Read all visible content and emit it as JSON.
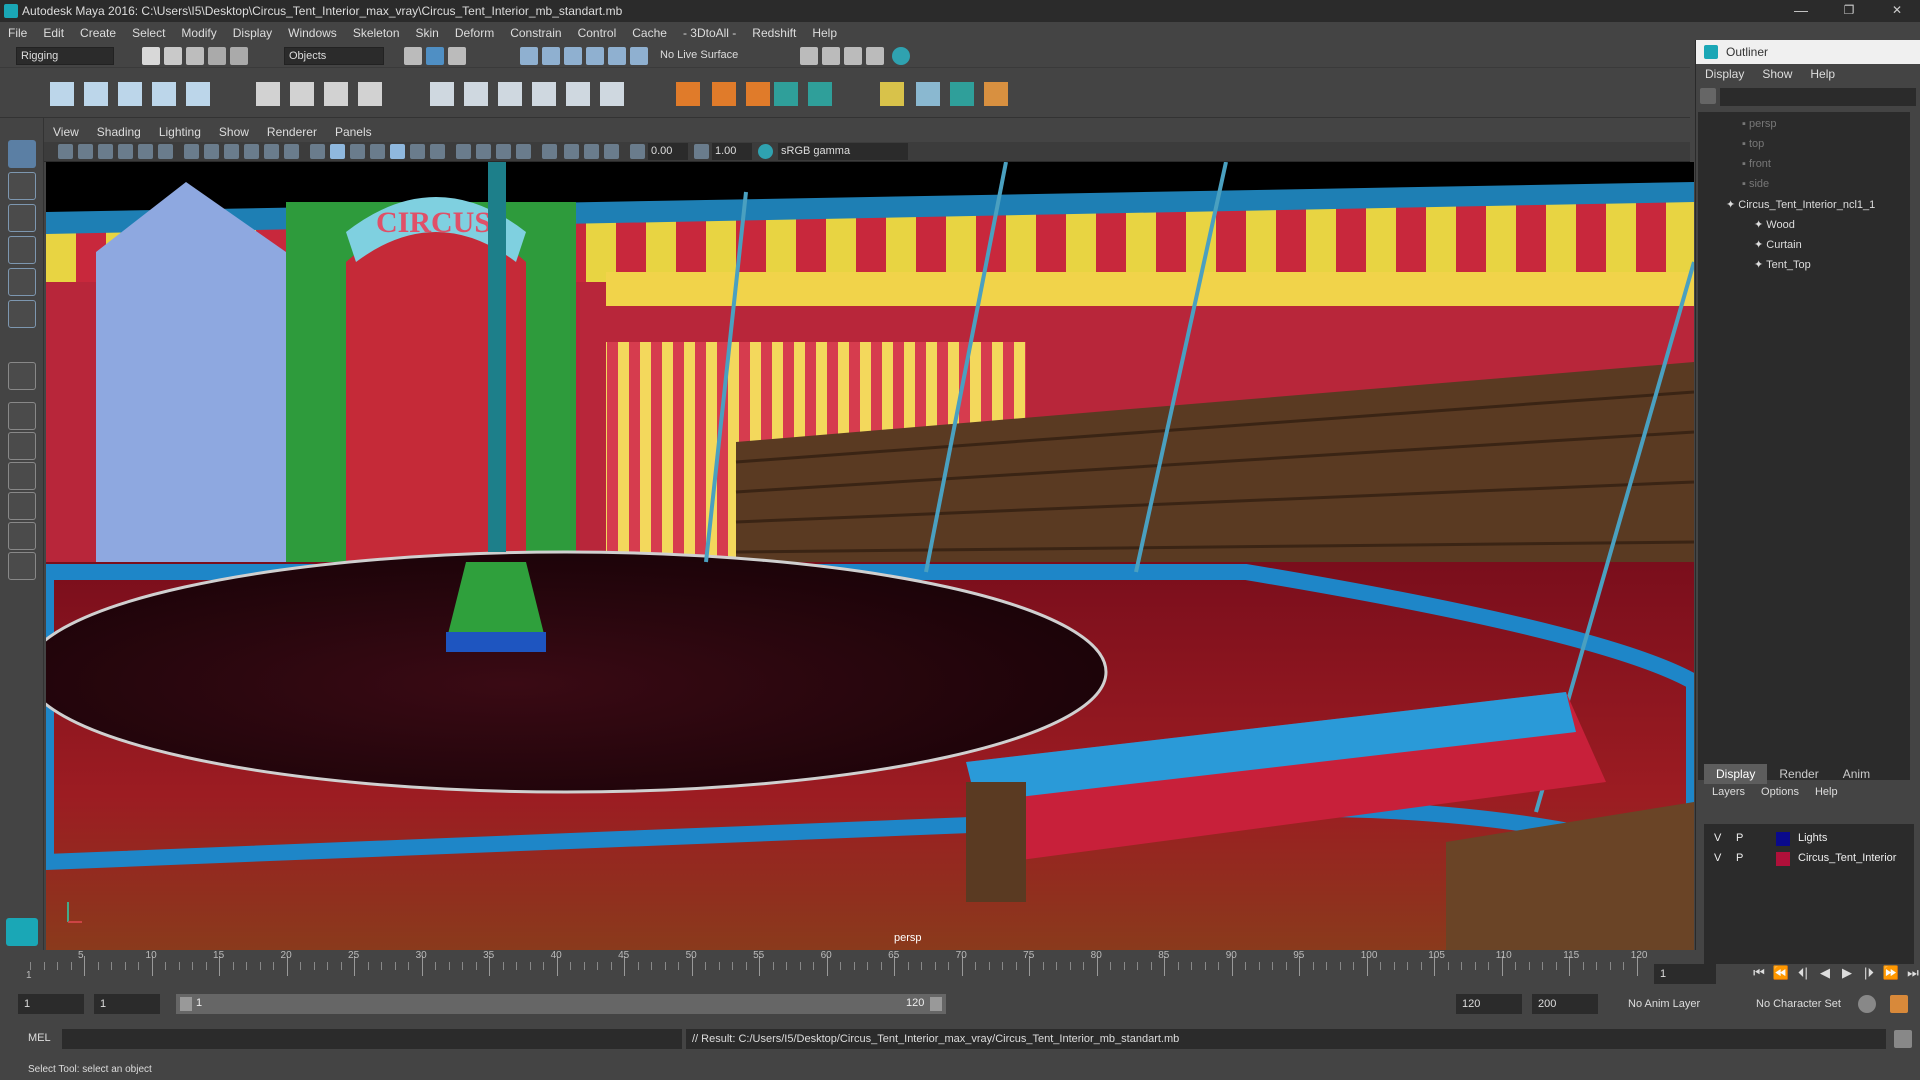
{
  "window": {
    "title": "Autodesk Maya 2016: C:\\Users\\I5\\Desktop\\Circus_Tent_Interior_max_vray\\Circus_Tent_Interior_mb_standart.mb",
    "minimize": "—",
    "maximize": "❐",
    "close": "✕"
  },
  "menubar": [
    "File",
    "Edit",
    "Create",
    "Select",
    "Modify",
    "Display",
    "Windows",
    "Skeleton",
    "Skin",
    "Deform",
    "Constrain",
    "Control",
    "Cache",
    "- 3DtoAll -",
    "Redshift",
    "Help"
  ],
  "shelf": {
    "mode": "Rigging",
    "selection_mask": "Objects",
    "live_surface": "No Live Surface"
  },
  "viewport": {
    "menu": [
      "View",
      "Shading",
      "Lighting",
      "Show",
      "Renderer",
      "Panels"
    ],
    "exposure": "0.00",
    "gamma": "1.00",
    "color_space": "sRGB gamma",
    "camera_label": "persp",
    "sign_text": "CIRCUS"
  },
  "outliner": {
    "title": "Outliner",
    "menu": [
      "Display",
      "Show",
      "Help"
    ],
    "items": [
      {
        "name": "persp",
        "dim": true
      },
      {
        "name": "top",
        "dim": true
      },
      {
        "name": "front",
        "dim": true
      },
      {
        "name": "side",
        "dim": true
      },
      {
        "name": "Circus_Tent_Interior_ncl1_1",
        "dim": false
      },
      {
        "name": "Wood",
        "dim": false
      },
      {
        "name": "Curtain",
        "dim": false
      },
      {
        "name": "Tent_Top",
        "dim": false
      }
    ]
  },
  "layers": {
    "tabs": [
      "Display",
      "Render",
      "Anim"
    ],
    "menu": [
      "Layers",
      "Options",
      "Help"
    ],
    "rows": [
      {
        "v": "V",
        "p": "P",
        "name": "Lights",
        "color": "#0a0a8c"
      },
      {
        "v": "V",
        "p": "P",
        "name": "Circus_Tent_Interior",
        "color": "#b0103a"
      }
    ]
  },
  "timeline": {
    "labels": [
      "5",
      "10",
      "15",
      "20",
      "25",
      "30",
      "35",
      "40",
      "45",
      "50",
      "55",
      "60",
      "65",
      "70",
      "75",
      "80",
      "85",
      "90",
      "95",
      "100",
      "105",
      "110",
      "115",
      "120"
    ],
    "start_marker": "1",
    "current_frame": "1"
  },
  "range": {
    "start": "1",
    "playback_start": "1",
    "slider_start": "1",
    "slider_end": "120",
    "playback_end": "120",
    "end": "200",
    "anim_layer": "No Anim Layer",
    "character_set": "No Character Set"
  },
  "command": {
    "lang": "MEL",
    "result": "// Result: C:/Users/I5/Desktop/Circus_Tent_Interior_max_vray/Circus_Tent_Interior_mb_standart.mb"
  },
  "status": "Select Tool: select an object",
  "playback": [
    "⏮",
    "⏪",
    "⏴|",
    "◀",
    "▶",
    "|⏵",
    "⏩",
    "⏭"
  ]
}
